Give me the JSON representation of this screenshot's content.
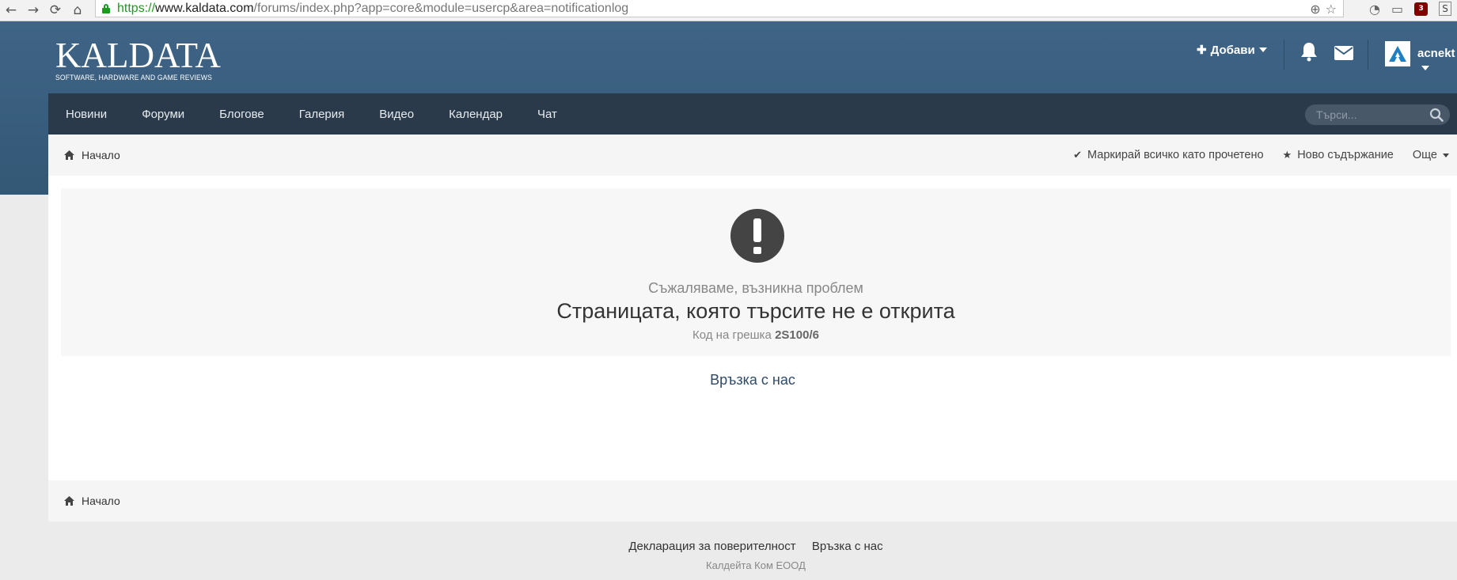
{
  "browser": {
    "url_scheme": "https://",
    "url_host": "www.kaldata.com",
    "url_path": "/forums/index.php?app=core&module=usercp&area=notificationlog",
    "ublock_badge": "3"
  },
  "site": {
    "logo_word": "KALDATA",
    "logo_tagline": "SOFTWARE, HARDWARE AND GAME REVIEWS",
    "add_label": "Добави",
    "username": "acnekt"
  },
  "nav": {
    "items": [
      "Новини",
      "Форуми",
      "Блогове",
      "Галерия",
      "Видео",
      "Календар",
      "Чат"
    ],
    "search_placeholder": "Търси..."
  },
  "breadcrumb": {
    "home": "Начало",
    "mark_read": "Маркирай всичко като прочетено",
    "new_content": "Ново съдържание",
    "more": "Още"
  },
  "error": {
    "subtitle": "Съжаляваме, възникна проблем",
    "title": "Страницата, която търсите не е открита",
    "code_label": "Код на грешка",
    "code": "2S100/6"
  },
  "contact_link": "Връзка с нас",
  "footer": {
    "privacy": "Декларация за поверителност",
    "contact": "Връзка с нас",
    "copyright": "Калдейта Ком ЕООД"
  },
  "colors": {
    "header_blue": "#3f6486",
    "nav_dark": "#2b3a4a",
    "link_blue": "#2e4a66"
  }
}
